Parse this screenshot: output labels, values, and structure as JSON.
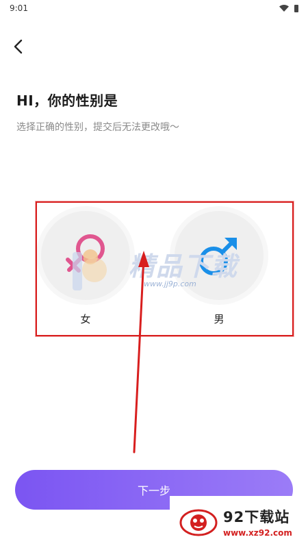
{
  "status_bar": {
    "time": "9:01",
    "icons": [
      "wifi-icon",
      "battery-icon"
    ]
  },
  "header": {
    "back_icon": "chevron-left-icon",
    "title": "HI，你的性别是",
    "subtitle": "选择正确的性别，提交后无法更改哦～"
  },
  "gender": {
    "options": [
      {
        "label": "女",
        "icon": "female-symbol-icon",
        "color": "#e0568f"
      },
      {
        "label": "男",
        "icon": "male-symbol-icon",
        "color": "#1a8fe8"
      }
    ]
  },
  "watermark": {
    "text": "精品下载",
    "url": "www.jj9p.com"
  },
  "footer": {
    "next_label": "下一步"
  },
  "site_badge": {
    "name": "92下载站",
    "url": "www.xz92.com"
  },
  "colors": {
    "accent_start": "#7b55f2",
    "accent_end": "#9b7cf7",
    "annotation": "#d81e1e"
  }
}
